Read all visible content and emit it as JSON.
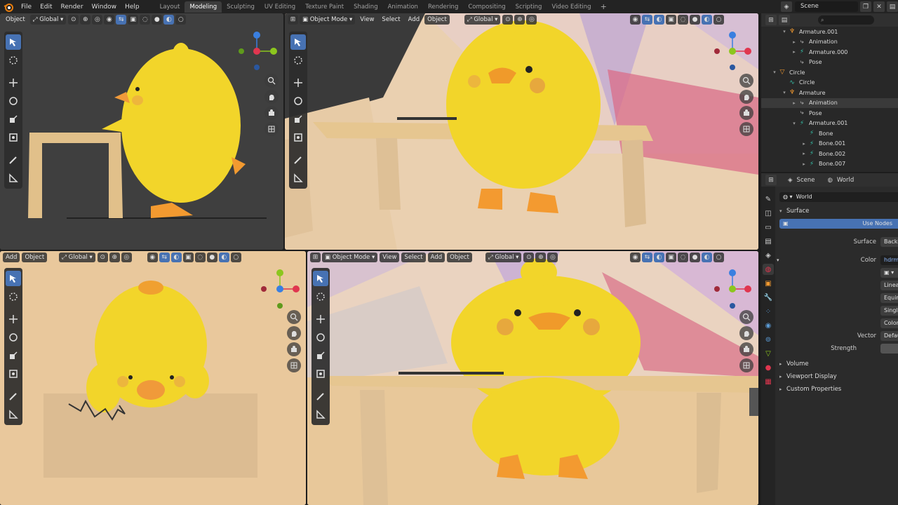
{
  "menu": {
    "file": "File",
    "edit": "Edit",
    "render": "Render",
    "window": "Window",
    "help": "Help"
  },
  "workspaces": [
    "Layout",
    "Modeling",
    "Sculpting",
    "UV Editing",
    "Texture Paint",
    "Shading",
    "Animation",
    "Rendering",
    "Compositing",
    "Scripting",
    "Video Editing"
  ],
  "active_workspace": "Modeling",
  "scene_name": "Scene",
  "viewports": {
    "tl": {
      "first": "Object",
      "orientation": "Global"
    },
    "tr": {
      "mode": "Object Mode",
      "view": "View",
      "select": "Select",
      "add": "Add",
      "object": "Object",
      "orientation": "Global"
    },
    "bl": {
      "add": "Add",
      "object": "Object",
      "orientation": "Global"
    },
    "br": {
      "mode": "Object Mode",
      "view": "View",
      "select": "Select",
      "add": "Add",
      "object": "Object",
      "orientation": "Global"
    }
  },
  "outliner": {
    "rows": [
      {
        "label": "Armature.001",
        "indent": 1,
        "icon": "armature",
        "arrow": "▾"
      },
      {
        "label": "Animation",
        "indent": 2,
        "icon": "action",
        "arrow": "▸"
      },
      {
        "label": "Armature.000",
        "indent": 2,
        "icon": "bone-data",
        "arrow": "▸"
      },
      {
        "label": "Pose",
        "indent": 2,
        "icon": "pose",
        "arrow": ""
      },
      {
        "label": "Circle",
        "indent": 0,
        "icon": "object",
        "arrow": "▾"
      },
      {
        "label": "Circle",
        "indent": 1,
        "icon": "curve",
        "arrow": ""
      },
      {
        "label": "Armature",
        "indent": 1,
        "icon": "armature",
        "arrow": "▾"
      },
      {
        "label": "Animation",
        "indent": 2,
        "icon": "action",
        "arrow": "▸",
        "highlight": true
      },
      {
        "label": "Pose",
        "indent": 2,
        "icon": "pose",
        "arrow": ""
      },
      {
        "label": "Armature.001",
        "indent": 2,
        "icon": "bone-data",
        "arrow": "▾"
      },
      {
        "label": "Bone",
        "indent": 3,
        "icon": "bone",
        "arrow": ""
      },
      {
        "label": "Bone.001",
        "indent": 3,
        "icon": "bone",
        "arrow": "▸"
      },
      {
        "label": "Bone.002",
        "indent": 3,
        "icon": "bone",
        "arrow": "▸"
      },
      {
        "label": "Bone.007",
        "indent": 3,
        "icon": "bone",
        "arrow": "▸"
      }
    ]
  },
  "properties": {
    "header_scene": "Scene",
    "header_world": "World",
    "world_name": "World",
    "surface_section": "Surface",
    "use_nodes": "Use Nodes",
    "surface_label": "Surface",
    "surface_value": "Backgr",
    "color_label": "Color",
    "color_value": "hdrmap",
    "linear": "Linear",
    "equirect": "Equirec",
    "single": "Single I",
    "color_space": "Color S",
    "vector_label": "Vector",
    "vector_value": "Default",
    "strength_label": "Strength",
    "volume": "Volume",
    "viewport_display": "Viewport Display",
    "custom_properties": "Custom Properties"
  },
  "colors": {
    "accent": "#4772b3",
    "chick": "#f2d52a",
    "table": "#e3c48e",
    "floor": "#e8c99a"
  }
}
